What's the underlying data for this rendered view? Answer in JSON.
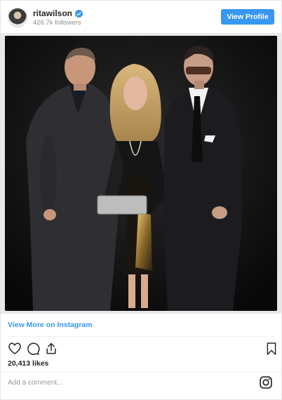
{
  "header": {
    "username": "ritawilson",
    "followers": "426.7k followers",
    "view_profile_label": "View Profile"
  },
  "post": {
    "image_icon": "photo-of-three-people"
  },
  "footer": {
    "view_more_label": "View More on Instagram",
    "likes": "20,413 likes",
    "comment_placeholder": "Add a comment..."
  },
  "icons": {
    "verified": "verified-badge-icon",
    "like": "heart-icon",
    "comment": "comment-icon",
    "share": "share-icon",
    "save": "bookmark-icon",
    "instagram": "instagram-logo-icon"
  },
  "colors": {
    "accent": "#3897f0",
    "text": "#262626",
    "muted": "#8e8e8e"
  }
}
